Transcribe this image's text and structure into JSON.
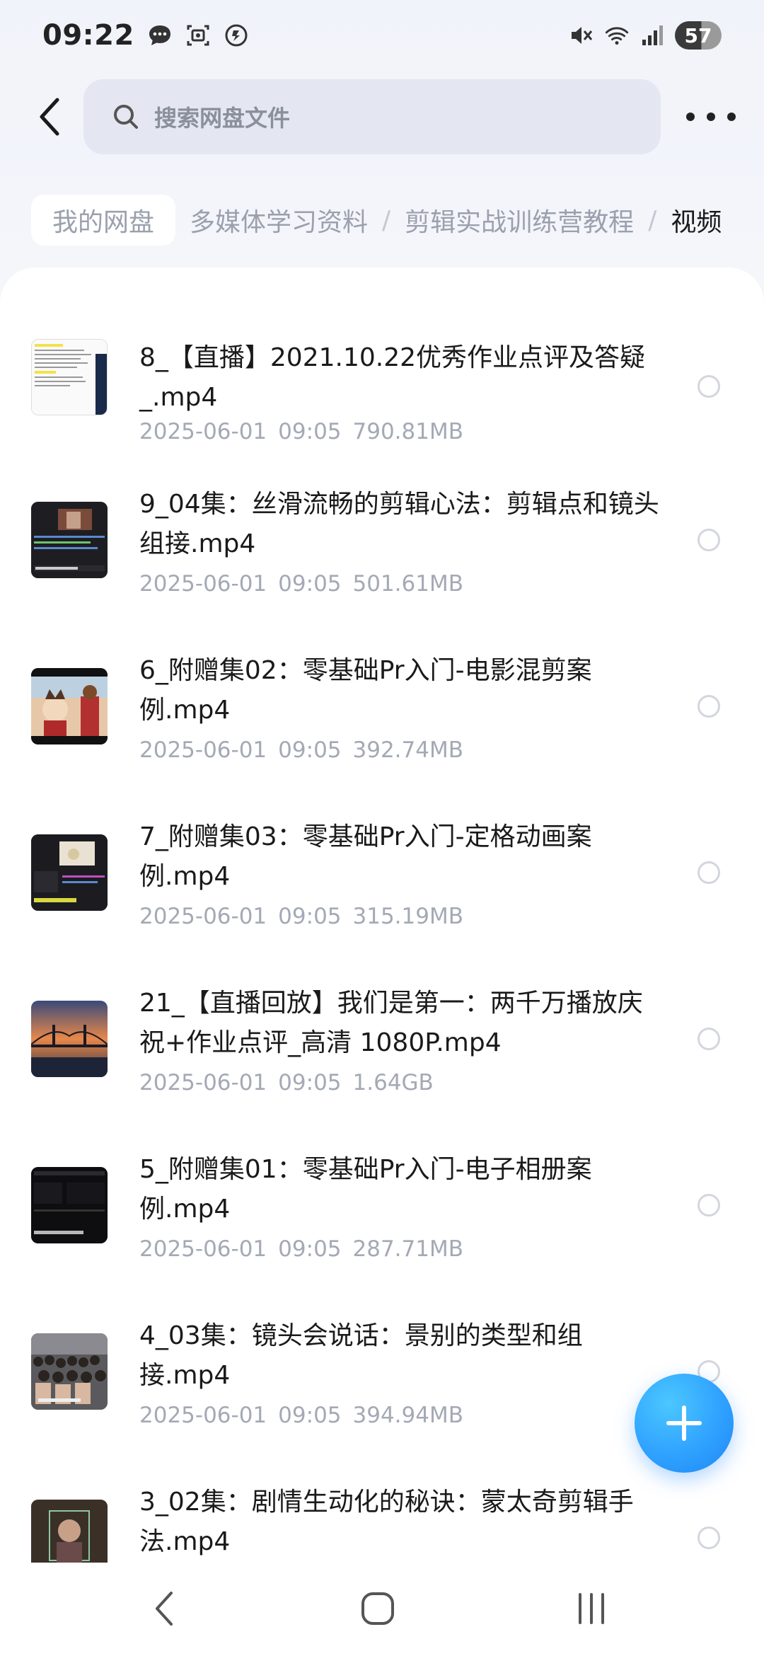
{
  "status_bar": {
    "time": "09:22",
    "battery": "57",
    "icons": [
      "message-bubble-icon",
      "screenshot-icon",
      "vpn-icon",
      "mute-icon",
      "wifi-icon",
      "signal-icon"
    ]
  },
  "search": {
    "placeholder": "搜索网盘文件"
  },
  "breadcrumb": {
    "root": "我的网盘",
    "items": [
      "多媒体学习资料",
      "剪辑实战训练营教程"
    ],
    "separator": "/",
    "current": "视频"
  },
  "files": [
    {
      "name": "8_【直播】2021.10.22优秀作业点评及答疑_.mp4",
      "date": "2025-06-01",
      "time": "09:05",
      "size": "790.81MB",
      "thumb": "document-thumb"
    },
    {
      "name": "9_04集：丝滑流畅的剪辑心法：剪辑点和镜头组接.mp4",
      "date": "2025-06-01",
      "time": "09:05",
      "size": "501.61MB",
      "thumb": "editor-thumb"
    },
    {
      "name": "6_附赠集02：零基础Pr入门-电影混剪案例.mp4",
      "date": "2025-06-01",
      "time": "09:05",
      "size": "392.74MB",
      "thumb": "anime-thumb"
    },
    {
      "name": "7_附赠集03：零基础Pr入门-定格动画案例.mp4",
      "date": "2025-06-01",
      "time": "09:05",
      "size": "315.19MB",
      "thumb": "editor-dark-thumb"
    },
    {
      "name": "21_【直播回放】我们是第一：两千万播放庆祝+作业点评_高清 1080P.mp4",
      "date": "2025-06-01",
      "time": "09:05",
      "size": "1.64GB",
      "thumb": "bridge-sunset-thumb"
    },
    {
      "name": "5_附赠集01：零基础Pr入门-电子相册案例.mp4",
      "date": "2025-06-01",
      "time": "09:05",
      "size": "287.71MB",
      "thumb": "editor-black-thumb"
    },
    {
      "name": "4_03集：镜头会说话：景别的类型和组接.mp4",
      "date": "2025-06-01",
      "time": "09:05",
      "size": "394.94MB",
      "thumb": "crowd-thumb"
    },
    {
      "name": "3_02集：剧情生动化的秘诀：蒙太奇剪辑手法.mp4",
      "date": "",
      "time": "",
      "size": "",
      "thumb": "portrait-thumb"
    }
  ],
  "colors": {
    "accent": "#2fa2ff",
    "meta": "#a4a9b5",
    "title": "#1a1a1a"
  }
}
